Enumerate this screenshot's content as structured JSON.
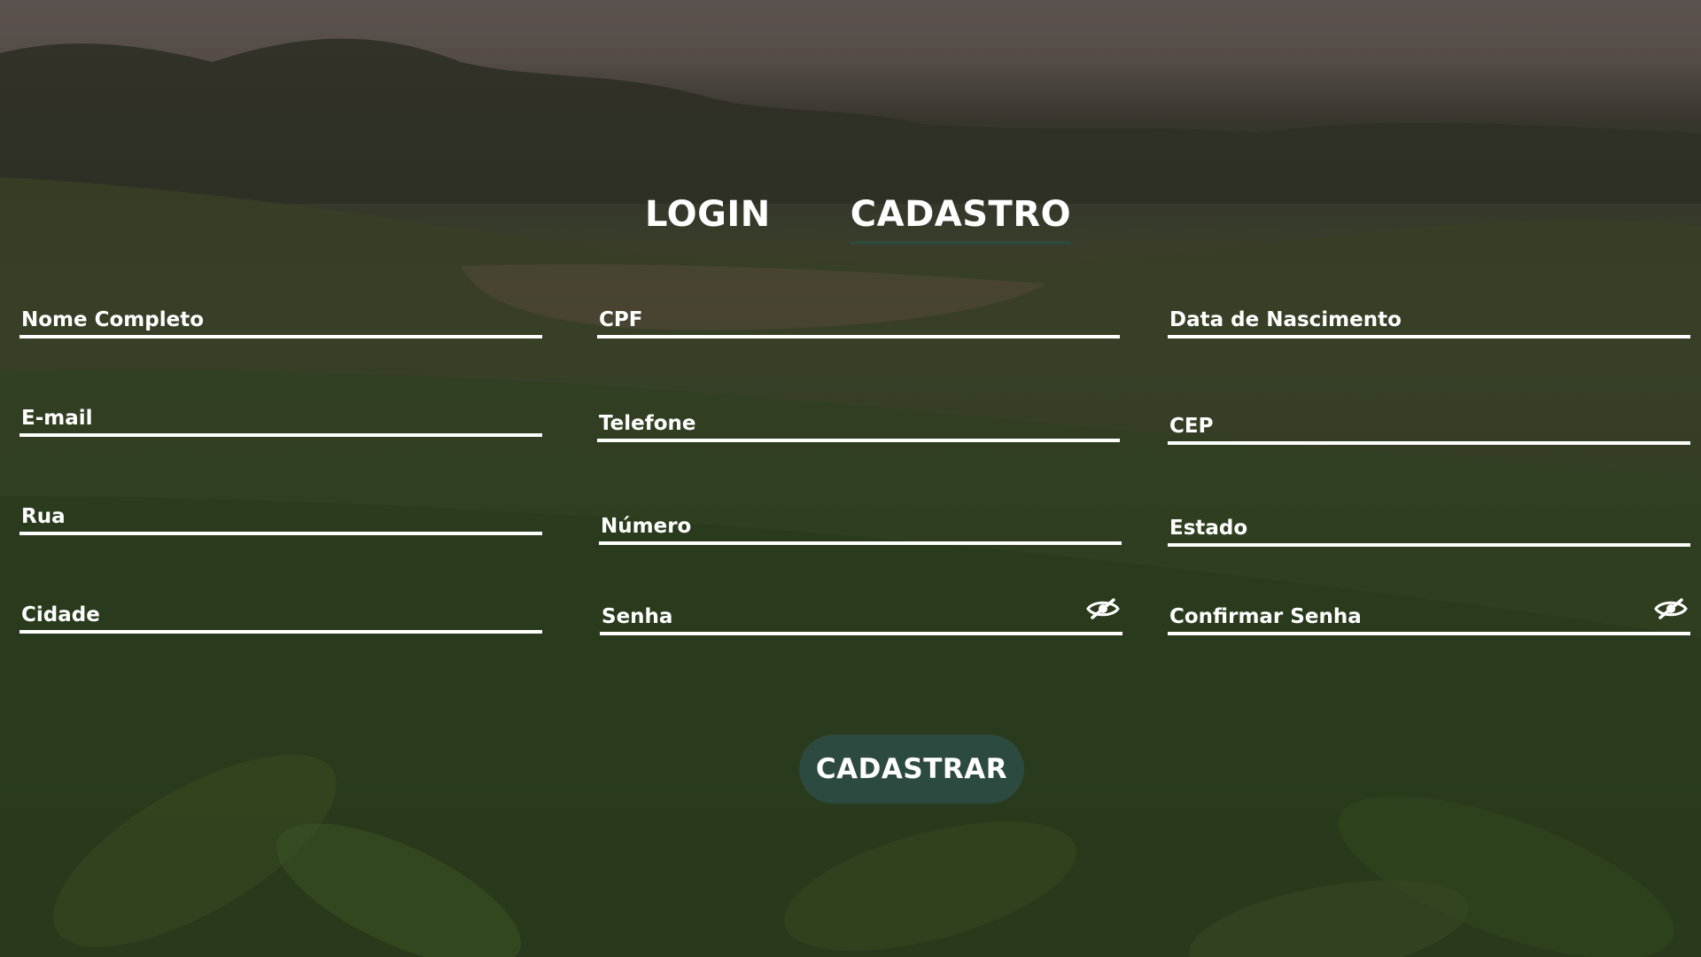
{
  "tabs": {
    "login": "LOGIN",
    "cadastro": "CADASTRO",
    "active": "cadastro"
  },
  "form": {
    "fields": {
      "nome_completo": "Nome Completo",
      "cpf": "CPF",
      "data_nascimento": "Data de Nascimento",
      "email": "E-mail",
      "telefone": "Telefone",
      "cep": "CEP",
      "rua": "Rua",
      "numero": "Número",
      "estado": "Estado",
      "cidade": "Cidade",
      "senha": "Senha",
      "confirmar_senha": "Confirmar Senha"
    },
    "submit_label": "CADASTRAR"
  },
  "icons": {
    "senha_toggle": "eye-slash-icon",
    "confirmar_senha_toggle": "eye-slash-icon"
  },
  "colors": {
    "accent": "#2c4a3f",
    "text": "#ffffff",
    "underline": "#ffffff"
  }
}
